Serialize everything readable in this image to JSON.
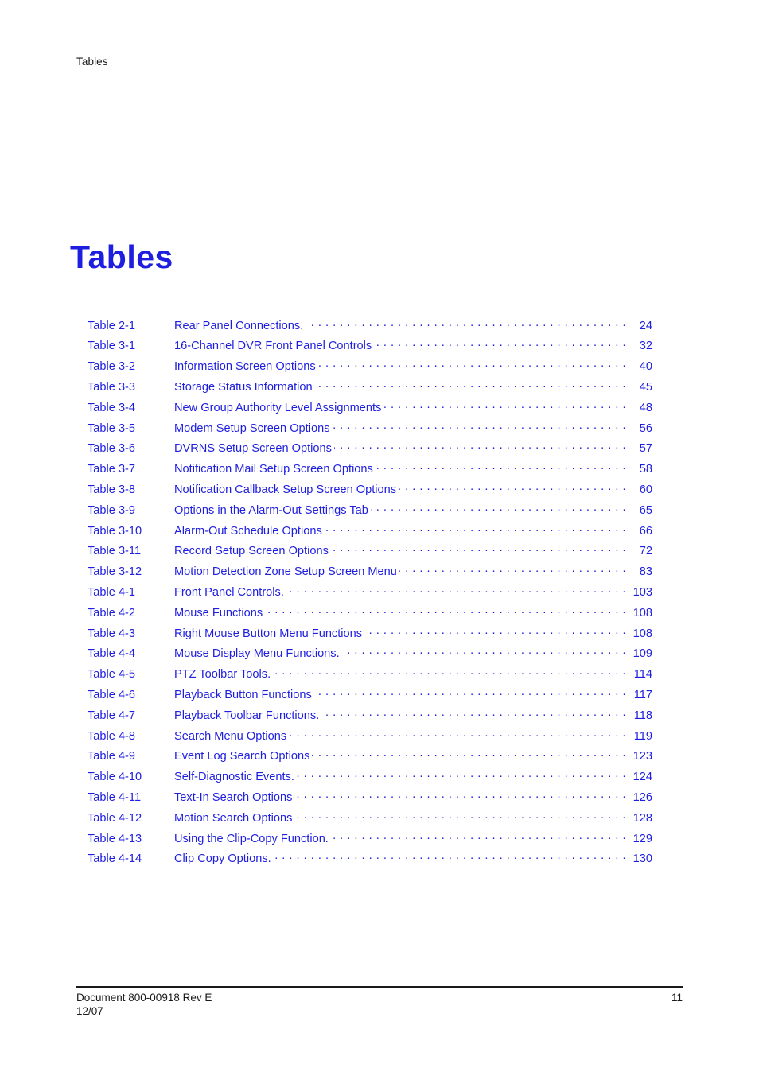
{
  "header": {
    "running_head": "Tables"
  },
  "title": "Tables",
  "colors": {
    "link_blue": "#1e1ee0",
    "body_black": "#1a1a1a"
  },
  "toc": {
    "entries": [
      {
        "label": "Table 2-1",
        "title": "Rear Panel Connections.",
        "page": "24"
      },
      {
        "label": "Table 3-1",
        "title": "16-Channel DVR Front Panel Controls",
        "page": "32"
      },
      {
        "label": "Table 3-2",
        "title": "Information Screen Options",
        "page": "40"
      },
      {
        "label": "Table 3-3",
        "title": "Storage Status Information",
        "page": "45"
      },
      {
        "label": "Table 3-4",
        "title": "New Group Authority Level Assignments",
        "page": "48"
      },
      {
        "label": "Table 3-5",
        "title": "Modem Setup Screen Options",
        "page": "56"
      },
      {
        "label": "Table 3-6",
        "title": "DVRNS Setup Screen Options",
        "page": "57"
      },
      {
        "label": "Table 3-7",
        "title": "Notification Mail Setup Screen Options",
        "page": "58"
      },
      {
        "label": "Table 3-8",
        "title": "Notification Callback Setup Screen Options",
        "page": "60"
      },
      {
        "label": "Table 3-9",
        "title": "Options in the Alarm-Out Settings Tab",
        "page": "65"
      },
      {
        "label": "Table 3-10",
        "title": "Alarm-Out Schedule Options",
        "page": "66"
      },
      {
        "label": "Table 3-11",
        "title": "Record Setup Screen Options",
        "page": "72"
      },
      {
        "label": "Table 3-12",
        "title": "Motion Detection Zone Setup Screen Menu",
        "page": "83"
      },
      {
        "label": "Table 4-1",
        "title": "Front Panel Controls.",
        "page": "103"
      },
      {
        "label": "Table 4-2",
        "title": "Mouse Functions",
        "page": "108"
      },
      {
        "label": "Table 4-3",
        "title": "Right Mouse Button Menu Functions",
        "page": "108"
      },
      {
        "label": "Table 4-4",
        "title": "Mouse Display Menu Functions.",
        "page": "109"
      },
      {
        "label": "Table 4-5",
        "title": "PTZ Toolbar Tools.",
        "page": "114"
      },
      {
        "label": "Table 4-6",
        "title": "Playback Button Functions",
        "page": "117"
      },
      {
        "label": "Table 4-7",
        "title": "Playback Toolbar Functions.",
        "page": "118"
      },
      {
        "label": "Table 4-8",
        "title": "Search Menu Options",
        "page": "119"
      },
      {
        "label": "Table 4-9",
        "title": "Event Log Search Options",
        "page": "123"
      },
      {
        "label": "Table 4-10",
        "title": "Self-Diagnostic Events.",
        "page": "124"
      },
      {
        "label": "Table 4-11",
        "title": "Text-In Search Options",
        "page": "126"
      },
      {
        "label": "Table 4-12",
        "title": "Motion Search Options",
        "page": "128"
      },
      {
        "label": "Table 4-13",
        "title": "Using the Clip-Copy Function.",
        "page": "129"
      },
      {
        "label": "Table 4-14",
        "title": "Clip Copy Options.",
        "page": "130"
      }
    ]
  },
  "footer": {
    "document_line": "Document 800-00918 Rev E",
    "date_line": "12/07",
    "page_number": "11"
  }
}
